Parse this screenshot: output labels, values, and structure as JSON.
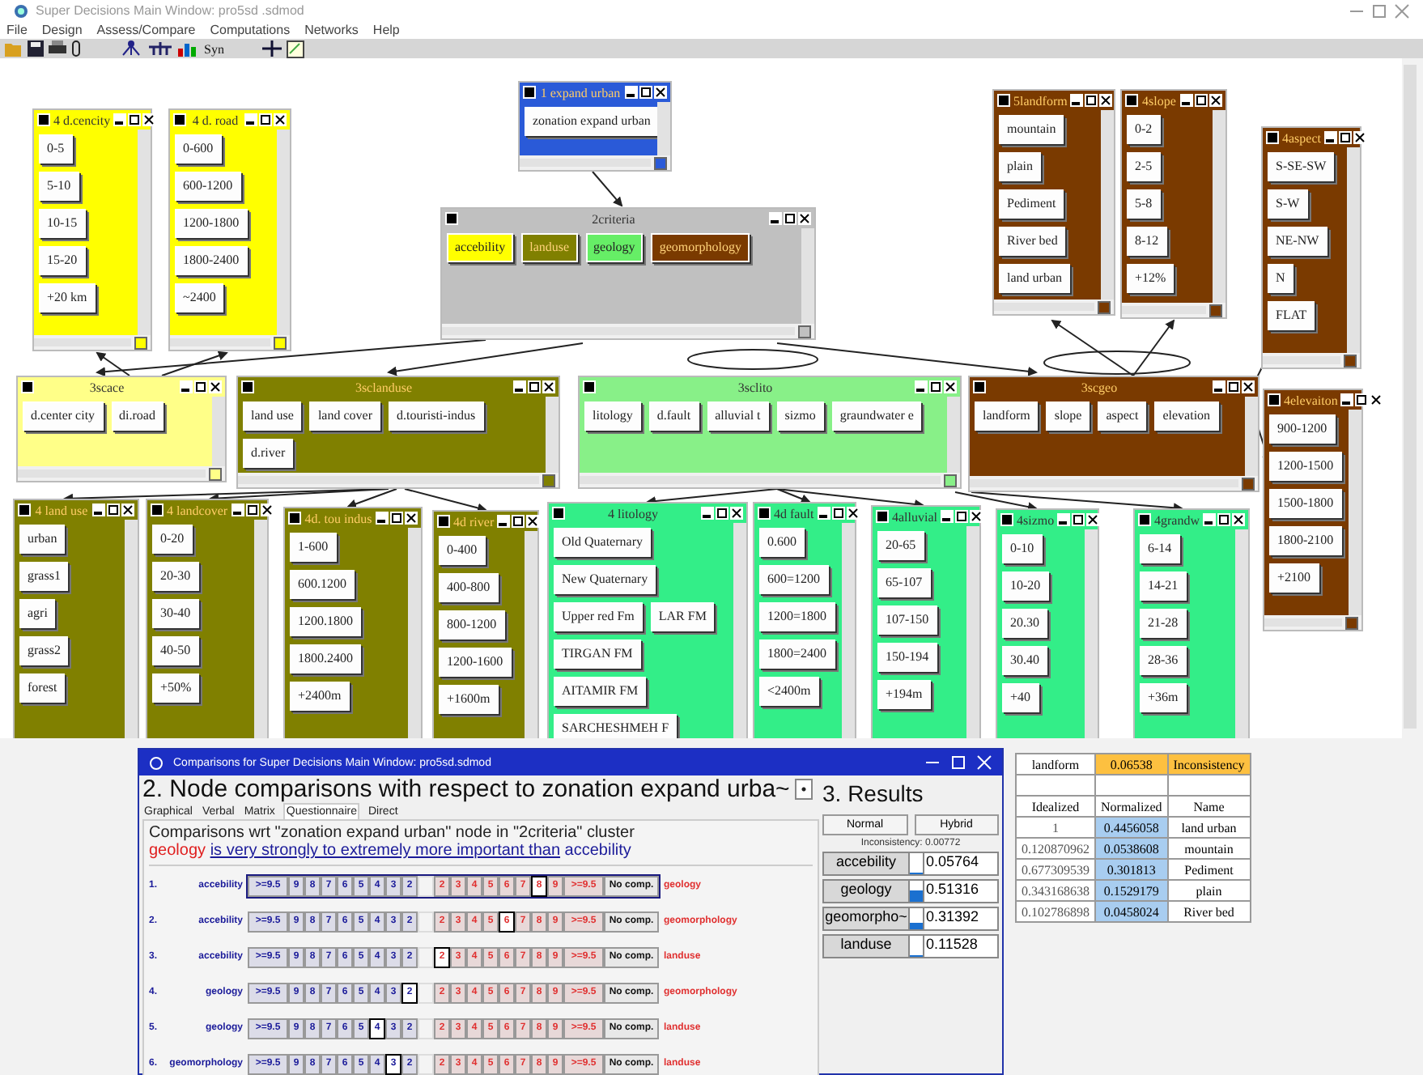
{
  "window": {
    "title": "Super Decisions Main Window: pro5sd .sdmod"
  },
  "menu": [
    "File",
    "Design",
    "Assess/Compare",
    "Computations",
    "Networks",
    "Help"
  ],
  "toolbar": {
    "syn_label": "Syn"
  },
  "clusters": [
    {
      "title": "4 d.cencity",
      "color": "#ffff00",
      "nodes": [
        {
          "label": "0-5"
        },
        {
          "label": "5-10"
        },
        {
          "label": "10-15"
        },
        {
          "label": "15-20"
        },
        {
          "label": "+20 km"
        }
      ]
    },
    {
      "title": "4 d. road",
      "color": "#ffff00",
      "nodes": [
        {
          "label": "0-600"
        },
        {
          "label": "600-1200"
        },
        {
          "label": "1200-1800"
        },
        {
          "label": "1800-2400"
        },
        {
          "label": "~2400"
        }
      ]
    },
    {
      "title": "1 expand urban",
      "color": "#2a5ad8",
      "nodes": [
        {
          "label": "zonation expand urban"
        }
      ]
    },
    {
      "title": "2criteria",
      "color": "#c0c0c0",
      "nodes": [
        {
          "label": "accebility",
          "color": "#ffff00"
        },
        {
          "label": "landuse",
          "color": "#808000"
        },
        {
          "label": "geology",
          "color": "#66ee66"
        },
        {
          "label": "geomorphology",
          "color": "#7a3a00"
        }
      ]
    },
    {
      "title": "5landform",
      "color": "#7a3a00",
      "nodes": [
        {
          "label": "mountain"
        },
        {
          "label": "plain"
        },
        {
          "label": "Pediment"
        },
        {
          "label": "River bed"
        },
        {
          "label": "land urban"
        }
      ]
    },
    {
      "title": "4slope",
      "color": "#7a3a00",
      "nodes": [
        {
          "label": "0-2"
        },
        {
          "label": "2-5"
        },
        {
          "label": "5-8"
        },
        {
          "label": "8-12"
        },
        {
          "label": "+12%"
        }
      ]
    },
    {
      "title": "4aspect",
      "color": "#7a3a00",
      "nodes": [
        {
          "label": "S-SE-SW"
        },
        {
          "label": "S-W"
        },
        {
          "label": "NE-NW"
        },
        {
          "label": "N"
        },
        {
          "label": "FLAT"
        }
      ]
    },
    {
      "title": "3scace",
      "color": "#ffff88",
      "nodes": [
        {
          "label": "d.center city"
        },
        {
          "label": "di.road"
        }
      ]
    },
    {
      "title": "3sclanduse",
      "color": "#808000",
      "nodes": [
        {
          "label": "land use"
        },
        {
          "label": "land cover"
        },
        {
          "label": "d.touristi-indus"
        },
        {
          "label": "d.river"
        }
      ]
    },
    {
      "title": "3sclito",
      "color": "#88f088",
      "nodes": [
        {
          "label": "litology"
        },
        {
          "label": "d.fault"
        },
        {
          "label": "alluvial t"
        },
        {
          "label": "sizmo"
        },
        {
          "label": "graundwater e"
        }
      ]
    },
    {
      "title": "3scgeo",
      "color": "#7a3a00",
      "nodes": [
        {
          "label": "landform"
        },
        {
          "label": "slope"
        },
        {
          "label": "aspect"
        },
        {
          "label": "elevation"
        }
      ]
    },
    {
      "title": "4elevaiton",
      "color": "#7a3a00",
      "nodes": [
        {
          "label": "900-1200"
        },
        {
          "label": "1200-1500"
        },
        {
          "label": "1500-1800"
        },
        {
          "label": "1800-2100"
        },
        {
          "label": "+2100"
        }
      ]
    },
    {
      "title": "4 land use",
      "color": "#808000",
      "nodes": [
        {
          "label": "urban"
        },
        {
          "label": "grass1"
        },
        {
          "label": "agri"
        },
        {
          "label": "grass2"
        },
        {
          "label": "forest"
        }
      ]
    },
    {
      "title": "4 landcover",
      "color": "#808000",
      "nodes": [
        {
          "label": "0-20"
        },
        {
          "label": "20-30"
        },
        {
          "label": "30-40"
        },
        {
          "label": "40-50"
        },
        {
          "label": "+50%"
        }
      ]
    },
    {
      "title": "4d. tou indus",
      "color": "#808000",
      "nodes": [
        {
          "label": "1-600"
        },
        {
          "label": "600.1200"
        },
        {
          "label": "1200.1800"
        },
        {
          "label": "1800.2400"
        },
        {
          "label": "+2400m"
        }
      ]
    },
    {
      "title": "4d river",
      "color": "#808000",
      "nodes": [
        {
          "label": "0-400"
        },
        {
          "label": "400-800"
        },
        {
          "label": "800-1200"
        },
        {
          "label": "1200-1600"
        },
        {
          "label": "+1600m"
        }
      ]
    },
    {
      "title": "4 litology",
      "color": "#33ee88",
      "nodes": [
        {
          "label": "Old Quaternary"
        },
        {
          "label": "New Quaternary"
        },
        {
          "label": "Upper red Fm"
        },
        {
          "label": "LAR FM"
        },
        {
          "label": "TIRGAN FM"
        },
        {
          "label": "AITAMIR FM"
        },
        {
          "label": "SARCHESHMEH F"
        }
      ]
    },
    {
      "title": "4d fault",
      "color": "#33ee88",
      "nodes": [
        {
          "label": "0.600"
        },
        {
          "label": "600=1200"
        },
        {
          "label": "1200=1800"
        },
        {
          "label": "1800=2400"
        },
        {
          "label": "<2400m"
        }
      ]
    },
    {
      "title": "4alluvial",
      "color": "#33ee88",
      "nodes": [
        {
          "label": "20-65"
        },
        {
          "label": "65-107"
        },
        {
          "label": "107-150"
        },
        {
          "label": "150-194"
        },
        {
          "label": "+194m"
        }
      ]
    },
    {
      "title": "4sizmo",
      "color": "#33ee88",
      "nodes": [
        {
          "label": "0-10"
        },
        {
          "label": "10-20"
        },
        {
          "label": "20.30"
        },
        {
          "label": "30.40"
        },
        {
          "label": "+40"
        }
      ]
    },
    {
      "title": "4grandw",
      "color": "#33ee88",
      "nodes": [
        {
          "label": "6-14"
        },
        {
          "label": "14-21"
        },
        {
          "label": "21-28"
        },
        {
          "label": "28-36"
        },
        {
          "label": "+36m"
        }
      ]
    }
  ],
  "comparisons": {
    "title": "Comparisons for Super Decisions Main Window: pro5sd.sdmod",
    "heading": "2. Node comparisons with respect to zonation expand urba~",
    "results_heading": "3. Results",
    "tabs": [
      {
        "label": "Graphical",
        "selected": false
      },
      {
        "label": "Verbal",
        "selected": false
      },
      {
        "label": "Matrix",
        "selected": false
      },
      {
        "label": "Questionnaire",
        "selected": true
      },
      {
        "label": "Direct",
        "selected": false
      }
    ],
    "wrt": "Comparisons wrt \"zonation expand urban\" node in \"2criteria\" cluster",
    "verdict": {
      "better": "geology",
      "phrase": "is very strongly to extremely more important than",
      "worse": "accebility"
    },
    "rows": [
      {
        "number": "1.",
        "left": "accebility",
        "right": "geology",
        "focused": true,
        "left_cells": [
          {
            "t": ">=9.5",
            "selected": false
          },
          {
            "t": "9",
            "selected": false
          },
          {
            "t": "8",
            "selected": false
          },
          {
            "t": "7",
            "selected": false
          },
          {
            "t": "6",
            "selected": false
          },
          {
            "t": "5",
            "selected": false
          },
          {
            "t": "4",
            "selected": false
          },
          {
            "t": "3",
            "selected": false
          },
          {
            "t": "2",
            "selected": false
          }
        ],
        "right_cells": [
          {
            "t": "2",
            "selected": false
          },
          {
            "t": "3",
            "selected": false
          },
          {
            "t": "4",
            "selected": false
          },
          {
            "t": "5",
            "selected": false
          },
          {
            "t": "6",
            "selected": false
          },
          {
            "t": "7",
            "selected": false
          },
          {
            "t": "8",
            "selected": true
          },
          {
            "t": "9",
            "selected": false
          },
          {
            "t": ">=9.5",
            "selected": false
          }
        ],
        "no_comp": "No comp."
      },
      {
        "number": "2.",
        "left": "accebility",
        "right": "geomorphology",
        "focused": false,
        "left_cells": [
          {
            "t": ">=9.5",
            "selected": false
          },
          {
            "t": "9",
            "selected": false
          },
          {
            "t": "8",
            "selected": false
          },
          {
            "t": "7",
            "selected": false
          },
          {
            "t": "6",
            "selected": false
          },
          {
            "t": "5",
            "selected": false
          },
          {
            "t": "4",
            "selected": false
          },
          {
            "t": "3",
            "selected": false
          },
          {
            "t": "2",
            "selected": false
          }
        ],
        "right_cells": [
          {
            "t": "2",
            "selected": false
          },
          {
            "t": "3",
            "selected": false
          },
          {
            "t": "4",
            "selected": false
          },
          {
            "t": "5",
            "selected": false
          },
          {
            "t": "6",
            "selected": true
          },
          {
            "t": "7",
            "selected": false
          },
          {
            "t": "8",
            "selected": false
          },
          {
            "t": "9",
            "selected": false
          },
          {
            "t": ">=9.5",
            "selected": false
          }
        ],
        "no_comp": "No comp."
      },
      {
        "number": "3.",
        "left": "accebility",
        "right": "landuse",
        "focused": false,
        "left_cells": [
          {
            "t": ">=9.5",
            "selected": false
          },
          {
            "t": "9",
            "selected": false
          },
          {
            "t": "8",
            "selected": false
          },
          {
            "t": "7",
            "selected": false
          },
          {
            "t": "6",
            "selected": false
          },
          {
            "t": "5",
            "selected": false
          },
          {
            "t": "4",
            "selected": false
          },
          {
            "t": "3",
            "selected": false
          },
          {
            "t": "2",
            "selected": false
          }
        ],
        "right_cells": [
          {
            "t": "2",
            "selected": true
          },
          {
            "t": "3",
            "selected": false
          },
          {
            "t": "4",
            "selected": false
          },
          {
            "t": "5",
            "selected": false
          },
          {
            "t": "6",
            "selected": false
          },
          {
            "t": "7",
            "selected": false
          },
          {
            "t": "8",
            "selected": false
          },
          {
            "t": "9",
            "selected": false
          },
          {
            "t": ">=9.5",
            "selected": false
          }
        ],
        "no_comp": "No comp."
      },
      {
        "number": "4.",
        "left": "geology",
        "right": "geomorphology",
        "focused": false,
        "left_cells": [
          {
            "t": ">=9.5",
            "selected": false
          },
          {
            "t": "9",
            "selected": false
          },
          {
            "t": "8",
            "selected": false
          },
          {
            "t": "7",
            "selected": false
          },
          {
            "t": "6",
            "selected": false
          },
          {
            "t": "5",
            "selected": false
          },
          {
            "t": "4",
            "selected": false
          },
          {
            "t": "3",
            "selected": false
          },
          {
            "t": "2",
            "selected": true
          }
        ],
        "right_cells": [
          {
            "t": "2",
            "selected": false
          },
          {
            "t": "3",
            "selected": false
          },
          {
            "t": "4",
            "selected": false
          },
          {
            "t": "5",
            "selected": false
          },
          {
            "t": "6",
            "selected": false
          },
          {
            "t": "7",
            "selected": false
          },
          {
            "t": "8",
            "selected": false
          },
          {
            "t": "9",
            "selected": false
          },
          {
            "t": ">=9.5",
            "selected": false
          }
        ],
        "no_comp": "No comp."
      },
      {
        "number": "5.",
        "left": "geology",
        "right": "landuse",
        "focused": false,
        "left_cells": [
          {
            "t": ">=9.5",
            "selected": false
          },
          {
            "t": "9",
            "selected": false
          },
          {
            "t": "8",
            "selected": false
          },
          {
            "t": "7",
            "selected": false
          },
          {
            "t": "6",
            "selected": false
          },
          {
            "t": "5",
            "selected": false
          },
          {
            "t": "4",
            "selected": true
          },
          {
            "t": "3",
            "selected": false
          },
          {
            "t": "2",
            "selected": false
          }
        ],
        "right_cells": [
          {
            "t": "2",
            "selected": false
          },
          {
            "t": "3",
            "selected": false
          },
          {
            "t": "4",
            "selected": false
          },
          {
            "t": "5",
            "selected": false
          },
          {
            "t": "6",
            "selected": false
          },
          {
            "t": "7",
            "selected": false
          },
          {
            "t": "8",
            "selected": false
          },
          {
            "t": "9",
            "selected": false
          },
          {
            "t": ">=9.5",
            "selected": false
          }
        ],
        "no_comp": "No comp."
      },
      {
        "number": "6.",
        "left": "geomorphology",
        "right": "landuse",
        "focused": false,
        "left_cells": [
          {
            "t": ">=9.5",
            "selected": false
          },
          {
            "t": "9",
            "selected": false
          },
          {
            "t": "8",
            "selected": false
          },
          {
            "t": "7",
            "selected": false
          },
          {
            "t": "6",
            "selected": false
          },
          {
            "t": "5",
            "selected": false
          },
          {
            "t": "4",
            "selected": false
          },
          {
            "t": "3",
            "selected": true
          },
          {
            "t": "2",
            "selected": false
          }
        ],
        "right_cells": [
          {
            "t": "2",
            "selected": false
          },
          {
            "t": "3",
            "selected": false
          },
          {
            "t": "4",
            "selected": false
          },
          {
            "t": "5",
            "selected": false
          },
          {
            "t": "6",
            "selected": false
          },
          {
            "t": "7",
            "selected": false
          },
          {
            "t": "8",
            "selected": false
          },
          {
            "t": "9",
            "selected": false
          },
          {
            "t": ">=9.5",
            "selected": false
          }
        ],
        "no_comp": "No comp."
      }
    ],
    "results": {
      "modes": [
        "Normal",
        "Hybrid"
      ],
      "inconsistency": "Inconsistency: 0.00772",
      "rows": [
        {
          "name": "accebility",
          "value": "0.05764",
          "level": 0.05764
        },
        {
          "name": "geology",
          "value": "0.51316",
          "level": 0.51316
        },
        {
          "name": "geomorpho~",
          "value": "0.31392",
          "level": 0.31392
        },
        {
          "name": "landuse",
          "value": "0.11528",
          "level": 0.11528
        }
      ]
    }
  },
  "priority_table": {
    "header": [
      "landform",
      "0.06538",
      "Inconsistency"
    ],
    "columns": [
      "Idealized",
      "Normalized",
      "Name"
    ],
    "rows": [
      [
        "1",
        "0.4456058",
        "land urban"
      ],
      [
        "0.120870962",
        "0.0538608",
        "mountain"
      ],
      [
        "0.677309539",
        "0.301813",
        "Pediment"
      ],
      [
        "0.343168638",
        "0.1529179",
        "plain"
      ],
      [
        "0.102786898",
        "0.0458024",
        "River bed"
      ]
    ]
  }
}
